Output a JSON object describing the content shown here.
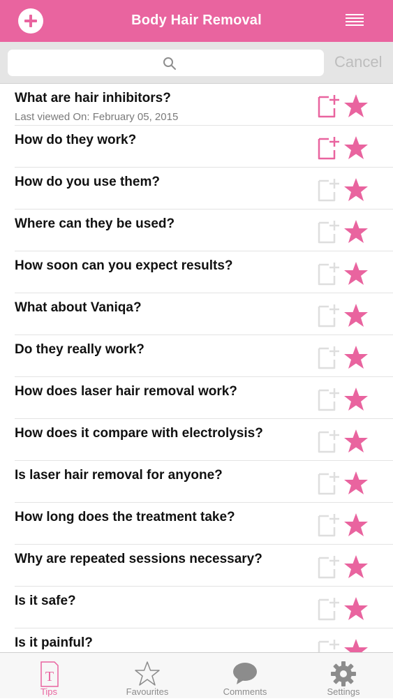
{
  "header": {
    "title": "Body Hair Removal",
    "add_icon": "plus-circle-icon",
    "menu_icon": "hamburger-menu-icon",
    "color": "#e9649f"
  },
  "search": {
    "placeholder": "",
    "cancel_label": "Cancel"
  },
  "accent_color": "#e9649f",
  "items": [
    {
      "question": "What are hair inhibitors?",
      "subtitle": "Last viewed On: February 05, 2015",
      "note_active": true,
      "favourite": true
    },
    {
      "question": "How do they work?",
      "subtitle": "",
      "note_active": true,
      "favourite": true
    },
    {
      "question": "How do you use them?",
      "subtitle": "",
      "note_active": false,
      "favourite": true
    },
    {
      "question": "Where can they be used?",
      "subtitle": "",
      "note_active": false,
      "favourite": true
    },
    {
      "question": "How soon can you expect results?",
      "subtitle": "",
      "note_active": false,
      "favourite": true
    },
    {
      "question": "What about Vaniqa?",
      "subtitle": "",
      "note_active": false,
      "favourite": true
    },
    {
      "question": "Do they really work?",
      "subtitle": "",
      "note_active": false,
      "favourite": true
    },
    {
      "question": "How does laser hair removal work?",
      "subtitle": "",
      "note_active": false,
      "favourite": true
    },
    {
      "question": "How does it compare with electrolysis?",
      "subtitle": "",
      "note_active": false,
      "favourite": true
    },
    {
      "question": "Is laser hair removal for anyone?",
      "subtitle": "",
      "note_active": false,
      "favourite": true
    },
    {
      "question": "How long does the treatment take?",
      "subtitle": "",
      "note_active": false,
      "favourite": true
    },
    {
      "question": "Why are repeated sessions necessary?",
      "subtitle": "",
      "note_active": false,
      "favourite": true
    },
    {
      "question": "Is it safe?",
      "subtitle": "",
      "note_active": false,
      "favourite": true
    },
    {
      "question": "Is it painful?",
      "subtitle": "",
      "note_active": false,
      "favourite": true
    }
  ],
  "tabs": [
    {
      "label": "Tips",
      "icon": "tips-document-icon",
      "active": true
    },
    {
      "label": "Favourites",
      "icon": "star-outline-icon",
      "active": false
    },
    {
      "label": "Comments",
      "icon": "speech-bubble-icon",
      "active": false
    },
    {
      "label": "Settings",
      "icon": "gear-icon",
      "active": false
    }
  ]
}
